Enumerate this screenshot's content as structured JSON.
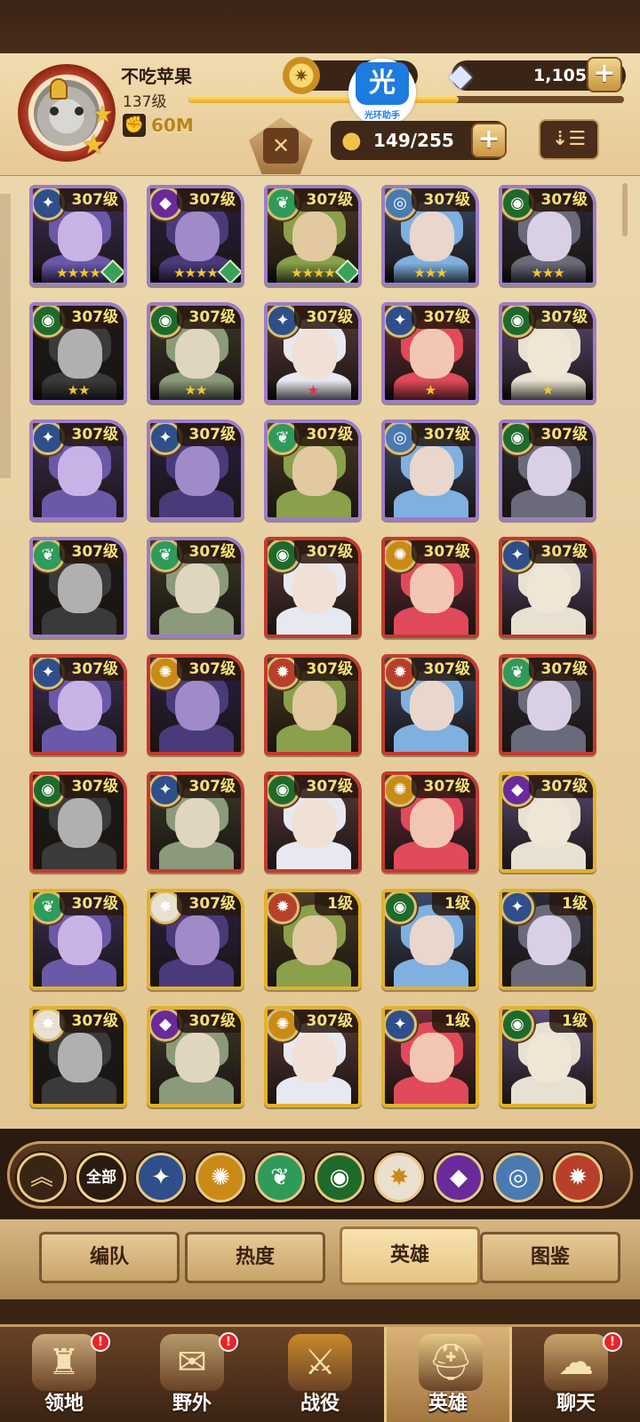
{
  "player": {
    "name": "不吃苹果",
    "level": "137级",
    "power": "60M",
    "exp_fraction": 0.62
  },
  "resources": {
    "gem_count": "1,105",
    "watermark_label": "光环助手",
    "watermark_glyph": "光"
  },
  "roster": {
    "count": "149/255"
  },
  "heroes": [
    {
      "level": "307级",
      "stars": "★★★★",
      "frame": "purple",
      "faction": "light",
      "hourglass": true
    },
    {
      "level": "307级",
      "stars": "★★★★",
      "frame": "purple",
      "faction": "dark",
      "hourglass": true
    },
    {
      "level": "307级",
      "stars": "★★★★",
      "frame": "purple",
      "faction": "forest",
      "hourglass": true
    },
    {
      "level": "307级",
      "stars": "★★★",
      "frame": "purple",
      "faction": "tech",
      "hourglass": false
    },
    {
      "level": "307级",
      "stars": "★★★",
      "frame": "purple",
      "faction": "wild",
      "hourglass": false
    },
    {
      "level": "307级",
      "stars": "★★",
      "frame": "purple",
      "faction": "wild",
      "hourglass": false
    },
    {
      "level": "307级",
      "stars": "★★",
      "frame": "purple",
      "faction": "wild",
      "hourglass": false
    },
    {
      "level": "307级",
      "stars": "★",
      "frame": "purple",
      "faction": "light",
      "hourglass": false,
      "star_color": "red"
    },
    {
      "level": "307级",
      "stars": "★",
      "frame": "purple",
      "faction": "light",
      "hourglass": false
    },
    {
      "level": "307级",
      "stars": "★",
      "frame": "purple",
      "faction": "wild",
      "hourglass": false
    },
    {
      "level": "307级",
      "stars": "",
      "frame": "purple",
      "faction": "light",
      "hourglass": false
    },
    {
      "level": "307级",
      "stars": "",
      "frame": "purple",
      "faction": "light",
      "hourglass": false
    },
    {
      "level": "307级",
      "stars": "",
      "frame": "purple",
      "faction": "forest",
      "hourglass": false
    },
    {
      "level": "307级",
      "stars": "",
      "frame": "purple",
      "faction": "tech",
      "hourglass": false
    },
    {
      "level": "307级",
      "stars": "",
      "frame": "purple",
      "faction": "wild",
      "hourglass": false
    },
    {
      "level": "307级",
      "stars": "",
      "frame": "purple",
      "faction": "forest",
      "hourglass": false
    },
    {
      "level": "307级",
      "stars": "",
      "frame": "purple",
      "faction": "forest",
      "hourglass": false
    },
    {
      "level": "307级",
      "stars": "",
      "frame": "red",
      "faction": "wild",
      "hourglass": false
    },
    {
      "level": "307级",
      "stars": "",
      "frame": "red",
      "faction": "fire",
      "hourglass": false
    },
    {
      "level": "307级",
      "stars": "",
      "frame": "red",
      "faction": "light",
      "hourglass": false
    },
    {
      "level": "307级",
      "stars": "",
      "frame": "red",
      "faction": "light",
      "hourglass": false
    },
    {
      "level": "307级",
      "stars": "",
      "frame": "red",
      "faction": "fire",
      "hourglass": false
    },
    {
      "level": "307级",
      "stars": "",
      "frame": "red",
      "faction": "flame",
      "hourglass": false
    },
    {
      "level": "307级",
      "stars": "",
      "frame": "red",
      "faction": "flame",
      "hourglass": false
    },
    {
      "level": "307级",
      "stars": "",
      "frame": "red",
      "faction": "forest",
      "hourglass": false
    },
    {
      "level": "307级",
      "stars": "",
      "frame": "red",
      "faction": "wild",
      "hourglass": false
    },
    {
      "level": "307级",
      "stars": "",
      "frame": "red",
      "faction": "light",
      "hourglass": false
    },
    {
      "level": "307级",
      "stars": "",
      "frame": "red",
      "faction": "wild",
      "hourglass": false
    },
    {
      "level": "307级",
      "stars": "",
      "frame": "red",
      "faction": "fire",
      "hourglass": false
    },
    {
      "level": "307级",
      "stars": "",
      "frame": "gold",
      "faction": "dark",
      "hourglass": false
    },
    {
      "level": "307级",
      "stars": "",
      "frame": "gold",
      "faction": "forest",
      "hourglass": false
    },
    {
      "level": "307级",
      "stars": "",
      "frame": "gold",
      "faction": "celestial",
      "hourglass": false
    },
    {
      "level": "1级",
      "stars": "",
      "frame": "gold",
      "faction": "flame",
      "hourglass": false
    },
    {
      "level": "1级",
      "stars": "",
      "frame": "gold",
      "faction": "wild",
      "hourglass": false
    },
    {
      "level": "1级",
      "stars": "",
      "frame": "gold",
      "faction": "light",
      "hourglass": false
    },
    {
      "level": "307级",
      "stars": "",
      "frame": "gold",
      "faction": "celestial",
      "hourglass": false
    },
    {
      "level": "307级",
      "stars": "",
      "frame": "gold",
      "faction": "dark",
      "hourglass": false
    },
    {
      "level": "307级",
      "stars": "",
      "frame": "gold",
      "faction": "fire",
      "hourglass": false
    },
    {
      "level": "1级",
      "stars": "",
      "frame": "gold",
      "faction": "light",
      "hourglass": false
    },
    {
      "level": "1级",
      "stars": "",
      "frame": "gold",
      "faction": "wild",
      "hourglass": false
    }
  ],
  "filters": [
    {
      "id": "collapse",
      "label": "",
      "icon": "chevron-up-icon",
      "glyph": "︽",
      "color": "#3a2414"
    },
    {
      "id": "all",
      "label": "全部",
      "icon": "",
      "glyph": "",
      "color": "#2a1a10"
    },
    {
      "id": "light",
      "label": "",
      "icon": "light-faction-icon",
      "glyph": "✦",
      "color": "#2e4f8a"
    },
    {
      "id": "fire",
      "label": "",
      "icon": "fire-faction-icon",
      "glyph": "✺",
      "color": "#c98a16"
    },
    {
      "id": "forest",
      "label": "",
      "icon": "forest-faction-icon",
      "glyph": "❦",
      "color": "#2f9a5a"
    },
    {
      "id": "wild",
      "label": "",
      "icon": "wild-faction-icon",
      "glyph": "◉",
      "color": "#1f6a2a"
    },
    {
      "id": "celestial",
      "label": "",
      "icon": "celestial-faction-icon",
      "glyph": "✸",
      "color": "#e9e0d0"
    },
    {
      "id": "dark",
      "label": "",
      "icon": "dark-faction-icon",
      "glyph": "◆",
      "color": "#6a2a9a"
    },
    {
      "id": "tech",
      "label": "",
      "icon": "tech-faction-icon",
      "glyph": "◎",
      "color": "#4a7ab0"
    },
    {
      "id": "flame",
      "label": "",
      "icon": "flame-faction-icon",
      "glyph": "✹",
      "color": "#b8402a"
    }
  ],
  "subtabs": [
    {
      "label": "编队",
      "active": false
    },
    {
      "label": "热度",
      "active": false
    },
    {
      "label": "英雄",
      "active": true
    },
    {
      "label": "图鉴",
      "active": false
    }
  ],
  "bottom_nav": [
    {
      "label": "领地",
      "icon": "castle-icon",
      "glyph": "♜",
      "notify": true,
      "active": false
    },
    {
      "label": "野外",
      "icon": "scroll-map-icon",
      "glyph": "✉",
      "notify": true,
      "active": false
    },
    {
      "label": "战役",
      "icon": "battle-crest-icon",
      "glyph": "⚔",
      "notify": false,
      "active": false
    },
    {
      "label": "英雄",
      "icon": "hero-helmet-icon",
      "glyph": "⛑",
      "notify": false,
      "active": true
    },
    {
      "label": "聊天",
      "icon": "chat-bubble-icon",
      "glyph": "☁",
      "notify": true,
      "active": false
    }
  ],
  "notif_glyph": "!",
  "colors": {
    "frame_purple": "#9b7cc8",
    "frame_red": "#c23a2e",
    "frame_gold": "#e3b12a",
    "level_text": "#f6e27a",
    "panel_bg": "#e9d2a6"
  }
}
